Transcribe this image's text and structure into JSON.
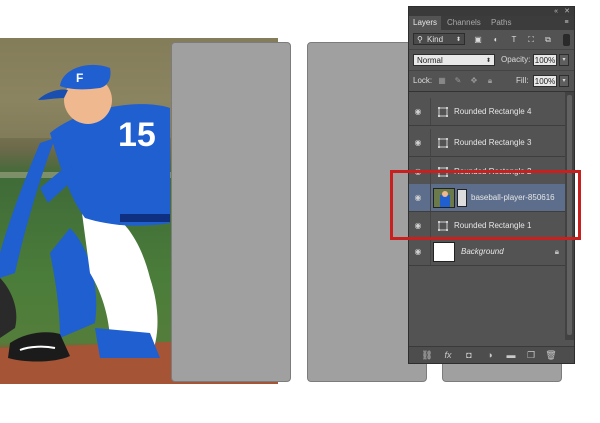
{
  "canvas": {
    "photo_name": "baseball-player-850616",
    "rectangles": [
      "Rounded Rectangle 1",
      "Rounded Rectangle 2",
      "Rounded Rectangle 3",
      "Rounded Rectangle 4"
    ],
    "rect_color": "#a0a0a0"
  },
  "panel": {
    "tabs": [
      {
        "label": "Layers",
        "active": true
      },
      {
        "label": "Channels",
        "active": false
      },
      {
        "label": "Paths",
        "active": false
      }
    ],
    "filter": {
      "kind_label": "Kind",
      "filter_icons": [
        "image-filter-icon",
        "adjustment-filter-icon",
        "type-filter-icon",
        "shape-filter-icon",
        "smart-object-filter-icon"
      ]
    },
    "blend_mode": "Normal",
    "opacity_label": "Opacity:",
    "opacity_value": "100%",
    "lock_label": "Lock:",
    "fill_label": "Fill:",
    "fill_value": "100%",
    "layers": [
      {
        "name": "Rounded Rectangle 4",
        "type": "shape",
        "selected": false
      },
      {
        "name": "Rounded Rectangle 3",
        "type": "shape",
        "selected": false
      },
      {
        "name": "Rounded Rectangle 2",
        "type": "shape",
        "selected": false
      },
      {
        "name": "baseball-player-850616",
        "type": "smart-object",
        "selected": true,
        "clipped": true
      },
      {
        "name": "Rounded Rectangle 1",
        "type": "shape",
        "selected": false
      },
      {
        "name": "Background",
        "type": "background",
        "selected": false,
        "locked": true
      }
    ],
    "bottom_icons": [
      "link-layers-icon",
      "fx-icon",
      "layer-mask-icon",
      "adjustment-layer-icon",
      "new-group-icon",
      "new-layer-icon",
      "delete-layer-icon"
    ],
    "fx_label": "fx"
  },
  "annotation": {
    "color": "#c8201e"
  }
}
